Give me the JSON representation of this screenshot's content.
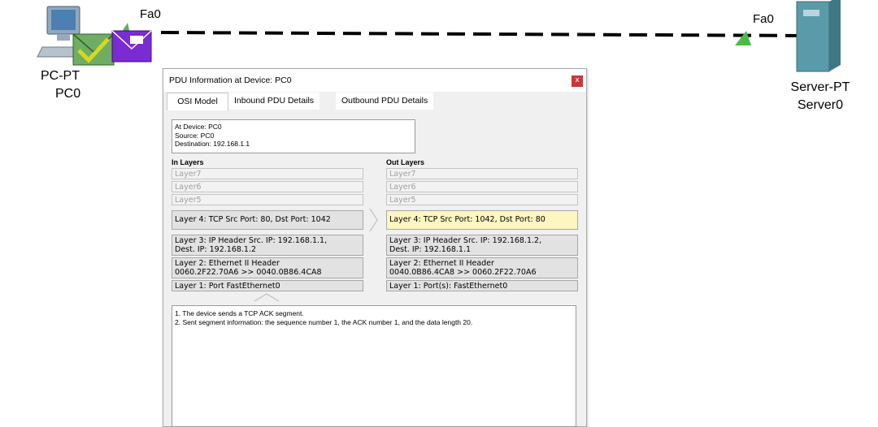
{
  "topology": {
    "pc": {
      "model": "PC-PT",
      "name": "PC0",
      "port": "Fa0"
    },
    "server": {
      "model": "Server-PT",
      "name": "Server0",
      "port": "Fa0"
    },
    "link_color": "#000000",
    "link_light_color": "#4cbb4c"
  },
  "dialog": {
    "title": "PDU Information at Device: PC0",
    "close_label": "x",
    "tabs": [
      {
        "label": "OSI Model",
        "active": true
      },
      {
        "label": "Inbound PDU Details",
        "active": false
      },
      {
        "label": "Outbound PDU Details",
        "active": false
      }
    ],
    "info": {
      "device": "At Device: PC0",
      "source": "Source: PC0",
      "destination": "Destination: 192.168.1.1"
    },
    "in_layers": {
      "header": "In Layers",
      "items": [
        "Layer7",
        "Layer6",
        "Layer5",
        "Layer 4: TCP Src Port: 80, Dst Port: 1042",
        "Layer 3: IP Header Src. IP: 192.168.1.1,",
        "Dest. IP: 192.168.1.2",
        "Layer 2: Ethernet II Header",
        "0060.2F22.70A6 >> 0040.0B86.4CA8",
        "Layer 1: Port FastEthernet0"
      ]
    },
    "out_layers": {
      "header": "Out Layers",
      "items": [
        "Layer7",
        "Layer6",
        "Layer5",
        "Layer 4: TCP Src Port: 1042, Dst Port: 80",
        "Layer 3: IP Header Src. IP: 192.168.1.2,",
        "Dest. IP: 192.168.1.1",
        "Layer 2: Ethernet II Header",
        "0040.0B86.4CA8 >> 0060.2F22.70A6",
        "Layer 1: Port(s): FastEthernet0"
      ]
    },
    "notes": [
      "1. The device sends a TCP ACK segment.",
      "2. Sent segment information: the sequence number 1, the ACK number 1, and the data length 20."
    ]
  },
  "colors": {
    "highlight": "#fdf6c0",
    "annotation_arrow": "#e02020",
    "close_button": "#c8383c"
  }
}
